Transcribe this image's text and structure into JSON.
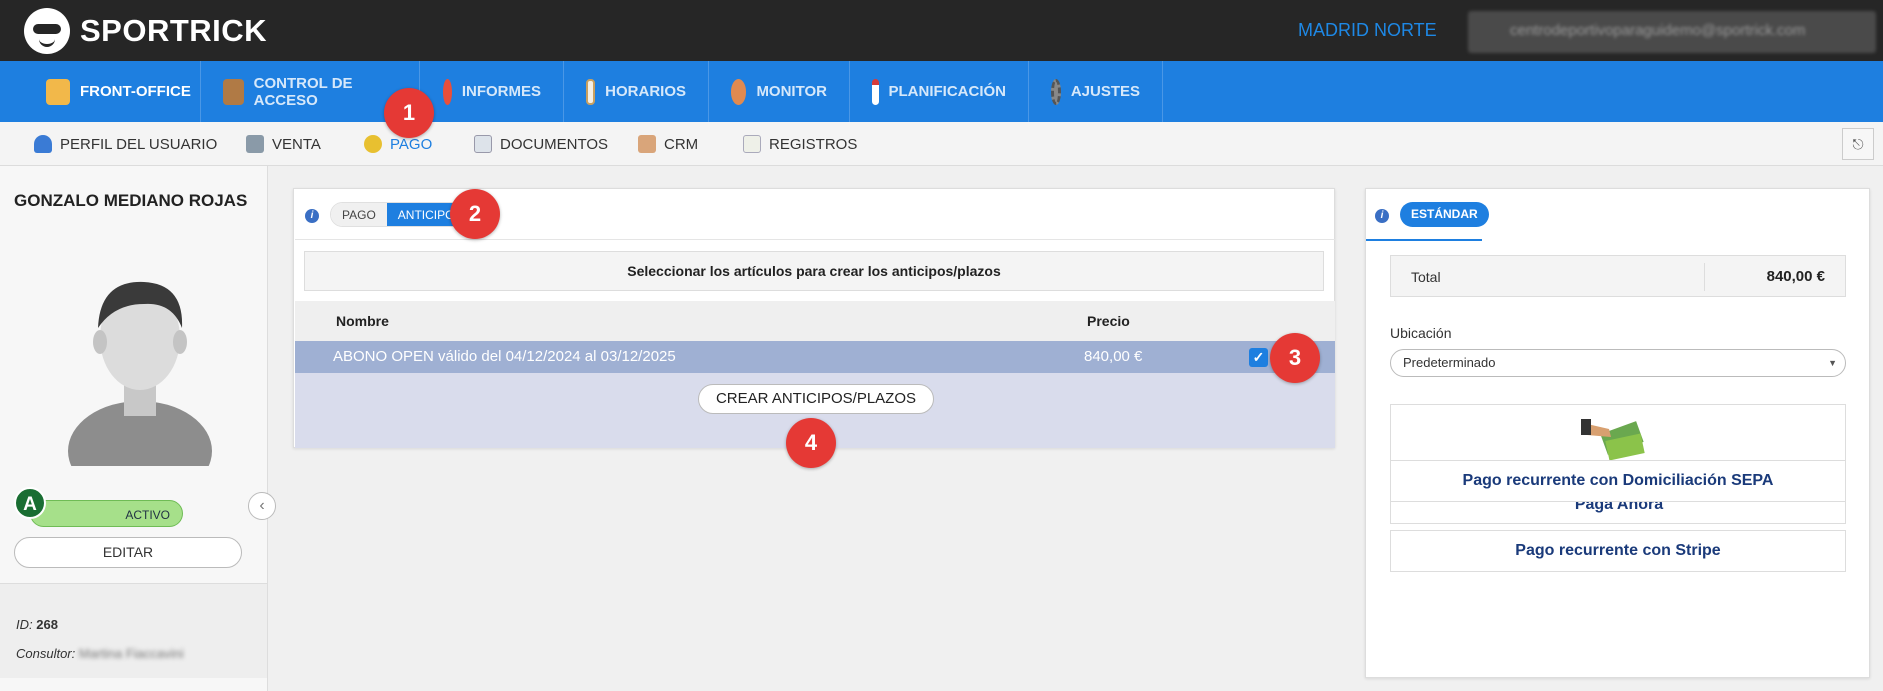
{
  "app": {
    "logo_text": "SPORTRICK",
    "center_name": "MADRID NORTE",
    "user_email": "centrodeportivoparaguidemo@sportrick.com"
  },
  "main_nav": [
    {
      "label": "FRONT-OFFICE",
      "icon": "front-office-icon",
      "active": true
    },
    {
      "label": "CONTROL DE ACCESO",
      "icon": "door-icon"
    },
    {
      "label": "INFORMES",
      "icon": "pie-chart-icon"
    },
    {
      "label": "HORARIOS",
      "icon": "calendar-grid-icon"
    },
    {
      "label": "MONITOR",
      "icon": "people-icon"
    },
    {
      "label": "PLANIFICACIÓN",
      "icon": "calendar-icon"
    },
    {
      "label": "AJUSTES",
      "icon": "gear-icon"
    }
  ],
  "sub_nav": [
    {
      "label": "PERFIL DEL USUARIO",
      "icon": "user-icon"
    },
    {
      "label": "VENTA",
      "icon": "cash-register-icon"
    },
    {
      "label": "PAGO",
      "icon": "coin-icon",
      "active": true
    },
    {
      "label": "DOCUMENTOS",
      "icon": "document-icon"
    },
    {
      "label": "CRM",
      "icon": "handshake-icon"
    },
    {
      "label": "REGISTROS",
      "icon": "log-icon"
    }
  ],
  "client": {
    "name": "GONZALO MEDIANO ROJAS",
    "badge": "A",
    "status": "ACTIVO",
    "edit_label": "EDITAR",
    "id_label": "ID:",
    "id_value": "268",
    "consultor_label": "Consultor:",
    "consultor_value": "Martina Fiaccavini"
  },
  "payment_panel": {
    "tab_pago": "PAGO",
    "tab_anticipo": "ANTICIPO",
    "instruction": "Seleccionar los artículos para crear los anticipos/plazos",
    "columns": [
      "Nombre",
      "Precio"
    ],
    "rows": [
      {
        "name": "ABONO OPEN válido del 04/12/2024 al 03/12/2025",
        "price": "840,00 €",
        "checked": true
      }
    ],
    "create_button": "CREAR ANTICIPOS/PLAZOS"
  },
  "summary_panel": {
    "tab": "ESTÁNDAR",
    "total_label": "Total",
    "total_value": "840,00 €",
    "ubicacion_label": "Ubicación",
    "ubicacion_value": "Predeterminado",
    "pay_now": "Paga Ahora",
    "sepa": "Pago recurrente con Domiciliación SEPA",
    "stripe": "Pago recurrente con Stripe"
  },
  "markers": [
    "1",
    "2",
    "3",
    "4"
  ],
  "colors": {
    "primary": "#1e7fe0",
    "topbar": "#262626",
    "marker": "#e53935",
    "row_selected": "#9fb0d3",
    "active_status": "#a6e08a"
  }
}
